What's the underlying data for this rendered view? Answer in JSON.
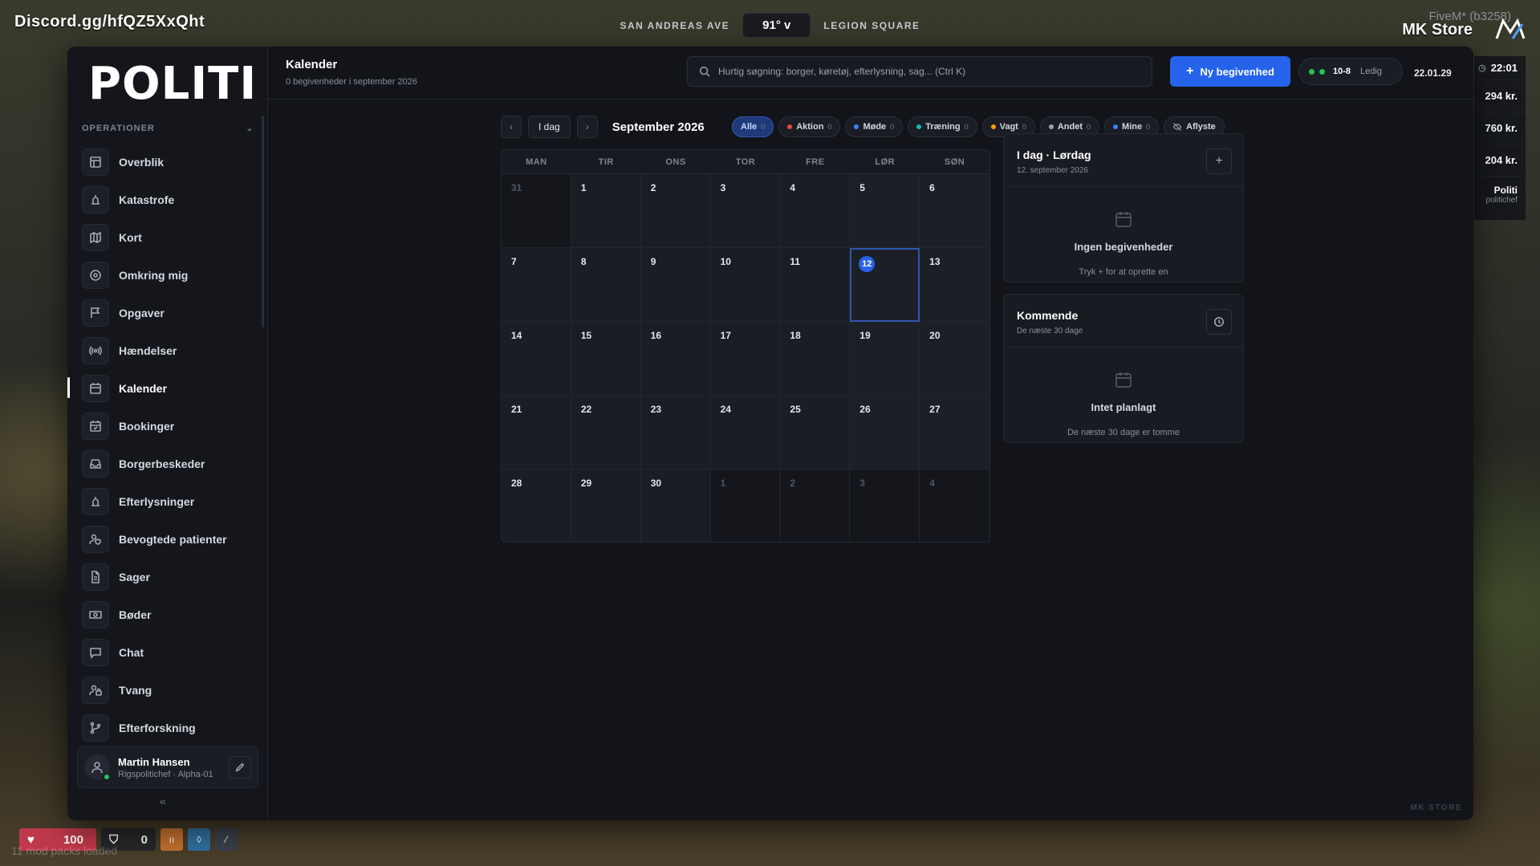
{
  "hud": {
    "discord": "Discord.gg/hfQZ5XxQht",
    "street_left": "SAN ANDREAS AVE",
    "temperature": "91° v",
    "street_right": "LEGION SQUARE",
    "fivem": "FiveM* (b3258)",
    "store": "MK Store",
    "time": "22:01",
    "money": [
      "294 kr.",
      "760 kr.",
      "204 kr."
    ],
    "role_title": "Politi",
    "role_sub": "politichef",
    "health": "100",
    "armor": "0",
    "mod_packs": "11 mod packs loaded"
  },
  "app": {
    "logo": "POLITI",
    "section_label": "OPERATIONER",
    "nav": [
      {
        "label": "Overblik",
        "icon": "layout-icon"
      },
      {
        "label": "Katastrofe",
        "icon": "siren-icon"
      },
      {
        "label": "Kort",
        "icon": "map-icon"
      },
      {
        "label": "Omkring mig",
        "icon": "radar-icon"
      },
      {
        "label": "Opgaver",
        "icon": "flag-icon"
      },
      {
        "label": "Hændelser",
        "icon": "radio-icon"
      },
      {
        "label": "Kalender",
        "icon": "calendar-icon"
      },
      {
        "label": "Bookinger",
        "icon": "calendar-check-icon"
      },
      {
        "label": "Borgerbeskeder",
        "icon": "inbox-icon"
      },
      {
        "label": "Efterlysninger",
        "icon": "siren-icon"
      },
      {
        "label": "Bevogtede patienter",
        "icon": "user-shield-icon"
      },
      {
        "label": "Sager",
        "icon": "file-icon"
      },
      {
        "label": "Bøder",
        "icon": "banknote-icon"
      },
      {
        "label": "Chat",
        "icon": "chat-icon"
      },
      {
        "label": "Tvang",
        "icon": "user-lock-icon"
      },
      {
        "label": "Efterforskning",
        "icon": "branch-icon"
      }
    ],
    "active_nav": "Kalender",
    "user": {
      "name": "Martin Hansen",
      "role": "Rigspolitichef · Alpha-01"
    },
    "collapse": "«"
  },
  "header": {
    "title": "Kalender",
    "subtitle": "0 begivenheder i september 2026",
    "search_placeholder": "Hurtig søgning: borger, køretøj, efterlysning, sag... (Ctrl K)",
    "new_button": "Ny begivenhed",
    "status_code": "10-8",
    "status_state": "Ledig",
    "clock": "22.01.29"
  },
  "calendar": {
    "today_button": "I dag",
    "month": "September 2026",
    "filters": [
      {
        "label": "Alle",
        "count": "0",
        "color": "",
        "active": true
      },
      {
        "label": "Aktion",
        "count": "0",
        "color": "#ef4444"
      },
      {
        "label": "Møde",
        "count": "0",
        "color": "#3b82f6"
      },
      {
        "label": "Træning",
        "count": "0",
        "color": "#14b8a6"
      },
      {
        "label": "Vagt",
        "count": "0",
        "color": "#f59e0b"
      },
      {
        "label": "Andet",
        "count": "0",
        "color": "#9ca3af"
      },
      {
        "label": "Mine",
        "count": "0",
        "color": "#3b82f6"
      }
    ],
    "cancelled_label": "Aflyste",
    "weekdays": [
      "MAN",
      "TIR",
      "ONS",
      "TOR",
      "FRE",
      "LØR",
      "SØN"
    ],
    "days": [
      "31",
      "1",
      "2",
      "3",
      "4",
      "5",
      "6",
      "7",
      "8",
      "9",
      "10",
      "11",
      "12",
      "13",
      "14",
      "15",
      "16",
      "17",
      "18",
      "19",
      "20",
      "21",
      "22",
      "23",
      "24",
      "25",
      "26",
      "27",
      "28",
      "29",
      "30",
      "1",
      "2",
      "3",
      "4"
    ],
    "other_month_indices": [
      0,
      31,
      32,
      33,
      34
    ],
    "today_index": 12
  },
  "today_panel": {
    "title": "I dag · Lørdag",
    "subtitle": "12. september 2026",
    "empty_title": "Ingen begivenheder",
    "empty_sub": "Tryk + for at oprette en"
  },
  "upcoming_panel": {
    "title": "Kommende",
    "subtitle": "De næste 30 dage",
    "empty_title": "Intet planlagt",
    "empty_sub": "De næste 30 dage er tomme"
  },
  "watermark": "MK STORE"
}
